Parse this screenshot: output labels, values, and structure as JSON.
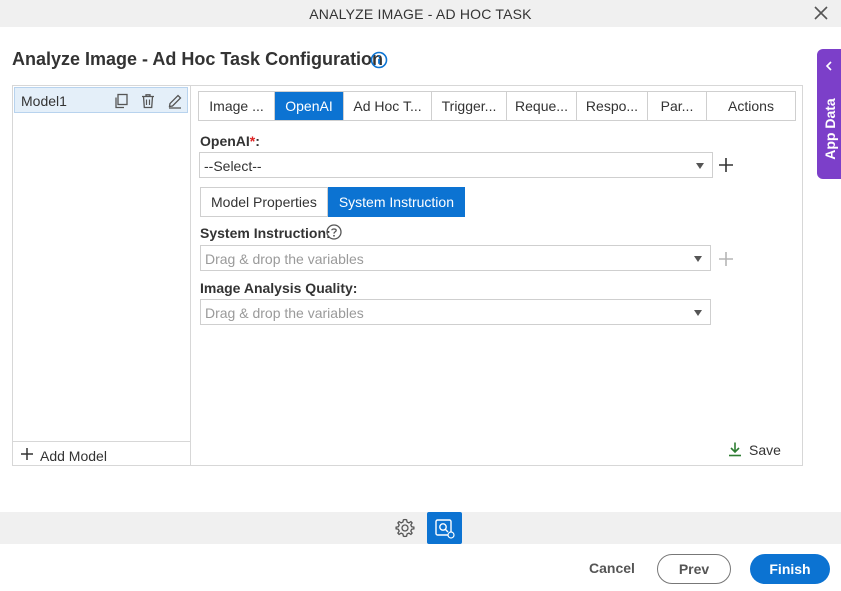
{
  "window": {
    "title": "ANALYZE IMAGE - AD HOC TASK"
  },
  "page": {
    "title": "Analyze Image - Ad Hoc Task Configuration"
  },
  "app_data_tab": {
    "label": "App Data"
  },
  "models": {
    "items": [
      {
        "name": "Model1"
      }
    ],
    "add_label": "Add Model"
  },
  "tabs": [
    {
      "label": "Image ...",
      "active": false
    },
    {
      "label": "OpenAI",
      "active": true
    },
    {
      "label": "Ad Hoc T...",
      "active": false
    },
    {
      "label": "Trigger...",
      "active": false
    },
    {
      "label": "Reque...",
      "active": false
    },
    {
      "label": "Respo...",
      "active": false
    },
    {
      "label": "Par...",
      "active": false
    },
    {
      "label": "Actions",
      "active": false
    }
  ],
  "form": {
    "openai_label": "OpenAI",
    "openai_required": "*",
    "openai_colon": ":",
    "openai_value": "--Select--",
    "subtabs": [
      {
        "label": "Model Properties",
        "active": false
      },
      {
        "label": "System Instruction",
        "active": true
      }
    ],
    "system_instruction_label": "System Instruction:",
    "system_instruction_placeholder": "Drag & drop the variables",
    "image_quality_label": "Image Analysis Quality:",
    "image_quality_placeholder": "Drag & drop the variables",
    "save_label": "Save"
  },
  "footer": {
    "cancel_label": "Cancel",
    "prev_label": "Prev",
    "finish_label": "Finish"
  },
  "colors": {
    "accent": "#0c73d2",
    "app_data_tab": "#7c3fc9",
    "required": "#dd2222",
    "save_icon": "#2e7d32"
  },
  "icons": {
    "close": "close-icon",
    "info": "info-icon",
    "app_data_chevron": "chevron-left-icon",
    "duplicate": "copy-icon",
    "delete": "trash-icon",
    "edit": "pencil-icon",
    "add": "plus-icon",
    "caret": "caret-down-icon",
    "help": "help-icon",
    "save": "download-icon",
    "settings": "gear-icon",
    "analyze": "image-scan-icon"
  }
}
